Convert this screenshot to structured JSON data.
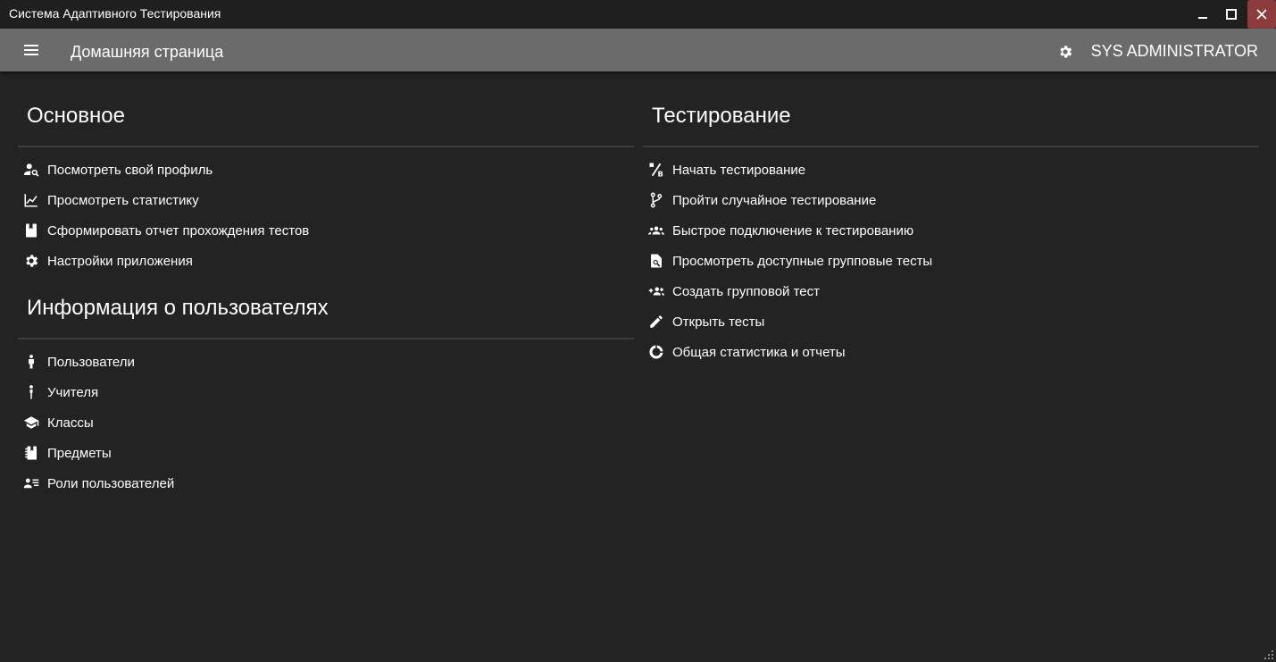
{
  "window": {
    "title": "Система Адаптивного Тестирования",
    "close_color": "#8c3c3c"
  },
  "appbar": {
    "page_title": "Домашняя страница",
    "username": "SYS ADMINISTRATOR",
    "background": "#6b6b6b"
  },
  "sections": {
    "main": {
      "title": "Основное",
      "items": [
        {
          "label": "Посмотреть свой профиль",
          "icon": "person-search-icon"
        },
        {
          "label": "Просмотреть статистику",
          "icon": "line-chart-icon"
        },
        {
          "label": "Сформировать отчет прохождения тестов",
          "icon": "report-book-icon"
        },
        {
          "label": "Настройки приложения",
          "icon": "gear-icon"
        }
      ]
    },
    "users": {
      "title": "Информация о пользователях",
      "items": [
        {
          "label": "Пользователи",
          "icon": "person-icon"
        },
        {
          "label": "Учителя",
          "icon": "teacher-icon"
        },
        {
          "label": "Классы",
          "icon": "graduation-cap-icon"
        },
        {
          "label": "Предметы",
          "icon": "notebook-icon"
        },
        {
          "label": "Роли пользователей",
          "icon": "account-list-icon"
        }
      ]
    },
    "testing": {
      "title": "Тестирование",
      "items": [
        {
          "label": "Начать тестирование",
          "icon": "percent-icon"
        },
        {
          "label": "Пройти случайное тестирование",
          "icon": "source-branch-icon"
        },
        {
          "label": "Быстрое подключение к тестированию",
          "icon": "group-icon"
        },
        {
          "label": "Просмотреть доступные групповые тесты",
          "icon": "file-search-icon"
        },
        {
          "label": "Создать групповой тест",
          "icon": "group-add-icon"
        },
        {
          "label": "Открыть тесты",
          "icon": "pencil-icon"
        },
        {
          "label": "Общая статистика и отчеты",
          "icon": "donut-chart-icon"
        }
      ]
    }
  }
}
